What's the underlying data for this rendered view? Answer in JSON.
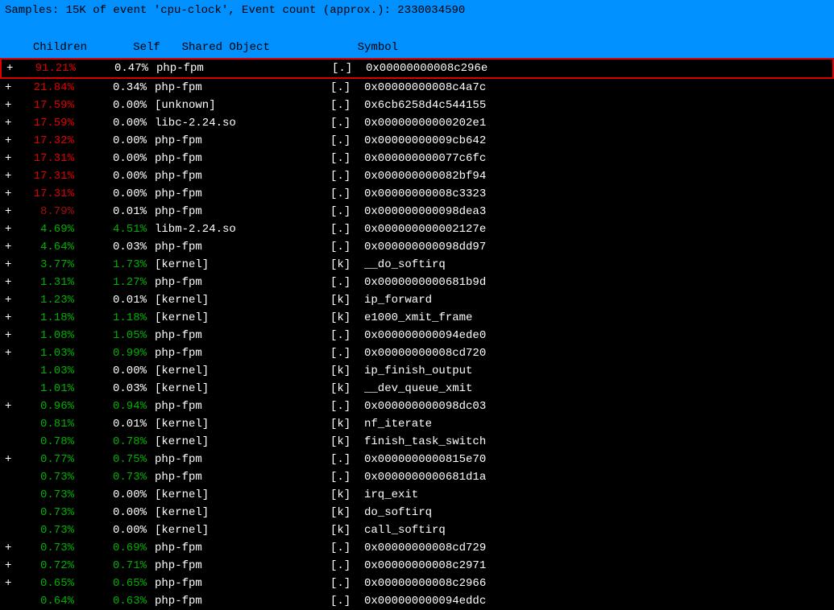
{
  "header": {
    "title": "Samples: 15K of event 'cpu-clock', Event count (approx.): 2330034590",
    "columns": {
      "children": "Children",
      "self": "Self",
      "shared": "Shared Object",
      "symbol": "Symbol"
    }
  },
  "rows": [
    {
      "plus": "+",
      "children": "91.21%",
      "childrenClass": "red",
      "self": "0.47%",
      "selfClass": "white",
      "shared": "php-fpm",
      "bracket": "[.]",
      "symbol": "0x00000000008c296e",
      "highlight": true
    },
    {
      "plus": "+",
      "children": "21.84%",
      "childrenClass": "red",
      "self": "0.34%",
      "selfClass": "white",
      "shared": "php-fpm",
      "bracket": "[.]",
      "symbol": "0x00000000008c4a7c"
    },
    {
      "plus": "+",
      "children": "17.59%",
      "childrenClass": "red",
      "self": "0.00%",
      "selfClass": "white",
      "shared": "[unknown]",
      "bracket": "[.]",
      "symbol": "0x6cb6258d4c544155"
    },
    {
      "plus": "+",
      "children": "17.59%",
      "childrenClass": "red",
      "self": "0.00%",
      "selfClass": "white",
      "shared": "libc-2.24.so",
      "bracket": "[.]",
      "symbol": "0x00000000000202e1"
    },
    {
      "plus": "+",
      "children": "17.32%",
      "childrenClass": "red",
      "self": "0.00%",
      "selfClass": "white",
      "shared": "php-fpm",
      "bracket": "[.]",
      "symbol": "0x00000000009cb642"
    },
    {
      "plus": "+",
      "children": "17.31%",
      "childrenClass": "red",
      "self": "0.00%",
      "selfClass": "white",
      "shared": "php-fpm",
      "bracket": "[.]",
      "symbol": "0x000000000077c6fc"
    },
    {
      "plus": "+",
      "children": "17.31%",
      "childrenClass": "red",
      "self": "0.00%",
      "selfClass": "white",
      "shared": "php-fpm",
      "bracket": "[.]",
      "symbol": "0x000000000082bf94"
    },
    {
      "plus": "+",
      "children": "17.31%",
      "childrenClass": "red",
      "self": "0.00%",
      "selfClass": "white",
      "shared": "php-fpm",
      "bracket": "[.]",
      "symbol": "0x00000000008c3323"
    },
    {
      "plus": "+",
      "children": "8.79%",
      "childrenClass": "darkred",
      "self": "0.01%",
      "selfClass": "white",
      "shared": "php-fpm",
      "bracket": "[.]",
      "symbol": "0x000000000098dea3"
    },
    {
      "plus": "+",
      "children": "4.69%",
      "childrenClass": "green",
      "self": "4.51%",
      "selfClass": "green",
      "shared": "libm-2.24.so",
      "bracket": "[.]",
      "symbol": "0x000000000002127e"
    },
    {
      "plus": "+",
      "children": "4.64%",
      "childrenClass": "green",
      "self": "0.03%",
      "selfClass": "white",
      "shared": "php-fpm",
      "bracket": "[.]",
      "symbol": "0x000000000098dd97"
    },
    {
      "plus": "+",
      "children": "3.77%",
      "childrenClass": "green",
      "self": "1.73%",
      "selfClass": "green",
      "shared": "[kernel]",
      "bracket": "[k]",
      "symbol": "__do_softirq"
    },
    {
      "plus": "+",
      "children": "1.31%",
      "childrenClass": "green",
      "self": "1.27%",
      "selfClass": "green",
      "shared": "php-fpm",
      "bracket": "[.]",
      "symbol": "0x0000000000681b9d"
    },
    {
      "plus": "+",
      "children": "1.23%",
      "childrenClass": "green",
      "self": "0.01%",
      "selfClass": "white",
      "shared": "[kernel]",
      "bracket": "[k]",
      "symbol": "ip_forward"
    },
    {
      "plus": "+",
      "children": "1.18%",
      "childrenClass": "green",
      "self": "1.18%",
      "selfClass": "green",
      "shared": "[kernel]",
      "bracket": "[k]",
      "symbol": "e1000_xmit_frame"
    },
    {
      "plus": "+",
      "children": "1.08%",
      "childrenClass": "green",
      "self": "1.05%",
      "selfClass": "green",
      "shared": "php-fpm",
      "bracket": "[.]",
      "symbol": "0x000000000094ede0"
    },
    {
      "plus": "+",
      "children": "1.03%",
      "childrenClass": "green",
      "self": "0.99%",
      "selfClass": "green",
      "shared": "php-fpm",
      "bracket": "[.]",
      "symbol": "0x00000000008cd720"
    },
    {
      "plus": " ",
      "children": "1.03%",
      "childrenClass": "green",
      "self": "0.00%",
      "selfClass": "white",
      "shared": "[kernel]",
      "bracket": "[k]",
      "symbol": "ip_finish_output"
    },
    {
      "plus": " ",
      "children": "1.01%",
      "childrenClass": "green",
      "self": "0.03%",
      "selfClass": "white",
      "shared": "[kernel]",
      "bracket": "[k]",
      "symbol": "__dev_queue_xmit"
    },
    {
      "plus": "+",
      "children": "0.96%",
      "childrenClass": "green",
      "self": "0.94%",
      "selfClass": "green",
      "shared": "php-fpm",
      "bracket": "[.]",
      "symbol": "0x000000000098dc03"
    },
    {
      "plus": " ",
      "children": "0.81%",
      "childrenClass": "green",
      "self": "0.01%",
      "selfClass": "white",
      "shared": "[kernel]",
      "bracket": "[k]",
      "symbol": "nf_iterate"
    },
    {
      "plus": " ",
      "children": "0.78%",
      "childrenClass": "green",
      "self": "0.78%",
      "selfClass": "green",
      "shared": "[kernel]",
      "bracket": "[k]",
      "symbol": "finish_task_switch"
    },
    {
      "plus": "+",
      "children": "0.77%",
      "childrenClass": "green",
      "self": "0.75%",
      "selfClass": "green",
      "shared": "php-fpm",
      "bracket": "[.]",
      "symbol": "0x0000000000815e70"
    },
    {
      "plus": " ",
      "children": "0.73%",
      "childrenClass": "green",
      "self": "0.73%",
      "selfClass": "green",
      "shared": "php-fpm",
      "bracket": "[.]",
      "symbol": "0x0000000000681d1a"
    },
    {
      "plus": " ",
      "children": "0.73%",
      "childrenClass": "green",
      "self": "0.00%",
      "selfClass": "white",
      "shared": "[kernel]",
      "bracket": "[k]",
      "symbol": "irq_exit"
    },
    {
      "plus": " ",
      "children": "0.73%",
      "childrenClass": "green",
      "self": "0.00%",
      "selfClass": "white",
      "shared": "[kernel]",
      "bracket": "[k]",
      "symbol": "do_softirq"
    },
    {
      "plus": " ",
      "children": "0.73%",
      "childrenClass": "green",
      "self": "0.00%",
      "selfClass": "white",
      "shared": "[kernel]",
      "bracket": "[k]",
      "symbol": "call_softirq"
    },
    {
      "plus": "+",
      "children": "0.73%",
      "childrenClass": "green",
      "self": "0.69%",
      "selfClass": "green",
      "shared": "php-fpm",
      "bracket": "[.]",
      "symbol": "0x00000000008cd729"
    },
    {
      "plus": "+",
      "children": "0.72%",
      "childrenClass": "green",
      "self": "0.71%",
      "selfClass": "green",
      "shared": "php-fpm",
      "bracket": "[.]",
      "symbol": "0x00000000008c2971"
    },
    {
      "plus": "+",
      "children": "0.65%",
      "childrenClass": "green",
      "self": "0.65%",
      "selfClass": "green",
      "shared": "php-fpm",
      "bracket": "[.]",
      "symbol": "0x00000000008c2966"
    },
    {
      "plus": " ",
      "children": "0.64%",
      "childrenClass": "green",
      "self": "0.63%",
      "selfClass": "green",
      "shared": "php-fpm",
      "bracket": "[.]",
      "symbol": "0x000000000094eddc"
    }
  ]
}
